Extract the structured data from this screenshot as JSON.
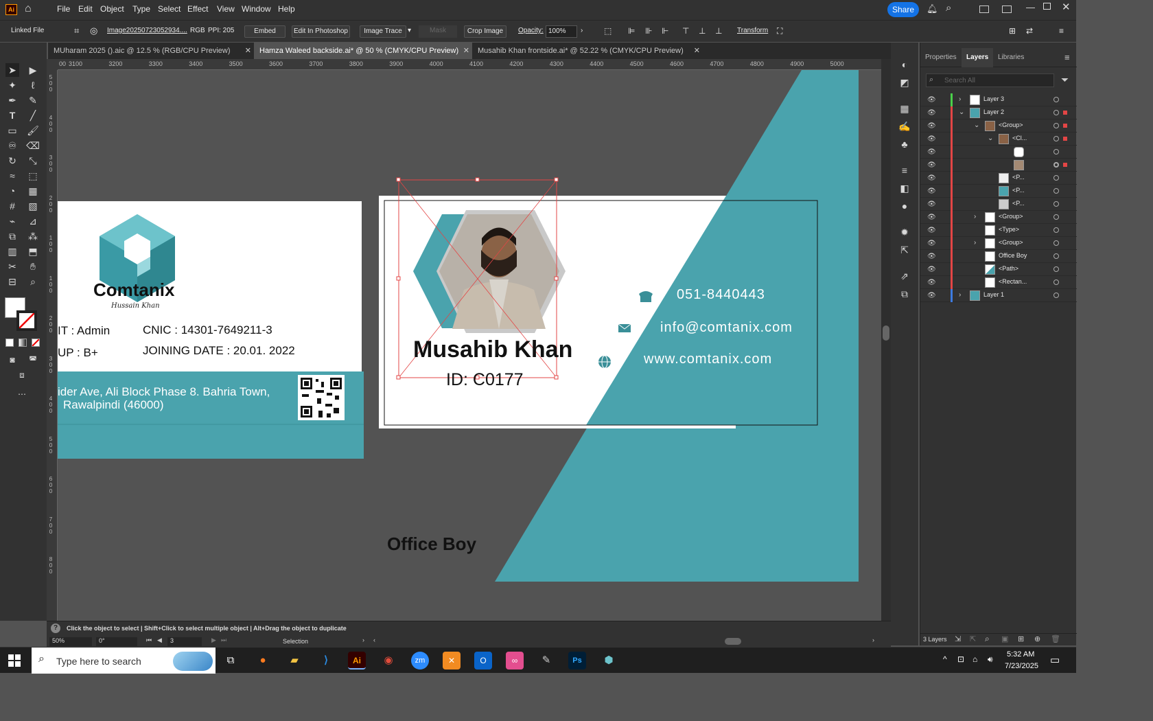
{
  "app": {
    "logo": "Ai",
    "menu": [
      "File",
      "Edit",
      "Object",
      "Type",
      "Select",
      "Effect",
      "View",
      "Window",
      "Help"
    ],
    "share": "Share"
  },
  "control": {
    "linked_file": "Linked File",
    "image_name": "Image20250723052934....",
    "color_mode": "RGB",
    "ppi": "PPI: 205",
    "embed": "Embed",
    "edit_photoshop": "Edit In Photoshop",
    "image_trace": "Image Trace",
    "mask": "Mask",
    "crop_image": "Crop Image",
    "opacity_label": "Opacity:",
    "opacity_value": "100%",
    "transform": "Transform"
  },
  "tabs": [
    {
      "label": "MUharam 2025 ().aic @ 12.5 % (RGB/CPU Preview)"
    },
    {
      "label": "Hamza Waleed backside.ai* @ 50 % (CMYK/CPU Preview)"
    },
    {
      "label": "Musahib Khan  frontside.ai* @ 52.22 % (CMYK/CPU Preview)"
    }
  ],
  "ruler_h": [
    "00",
    "3100",
    "3200",
    "3300",
    "3400",
    "3500",
    "3600",
    "3700",
    "3800",
    "3900",
    "4000",
    "4100",
    "4200",
    "4300",
    "4400",
    "4500",
    "4600",
    "4700",
    "4800",
    "4900",
    "5000"
  ],
  "ruler_v": [
    "5\n0\n0",
    "4\n0\n0",
    "3\n0\n0",
    "2\n0\n0",
    "1\n0\n0",
    "1\n0\n0",
    "2\n0\n0",
    "3\n0\n0",
    "4\n0\n0",
    "5\n0\n0",
    "6\n0\n0",
    "7\n0\n0",
    "8\n0\n0"
  ],
  "back_card": {
    "brand": "Comtanix",
    "signature": "Hussain Khan",
    "dept": "IT : Admin",
    "group": "UP : B+",
    "cnic": "CNIC : 14301-7649211-3",
    "joining": "JOINING DATE : 20.01. 2022",
    "address1": "ider Ave, Ali Block Phase 8. Bahria Town,",
    "address2": "Rawalpindi (46000)"
  },
  "front_card": {
    "name": "Musahib Khan",
    "id": "ID: C0177",
    "phone": "051-8440443",
    "email": "info@comtanix.com",
    "web": "www.comtanix.com",
    "role": "Office Boy"
  },
  "colors": {
    "teal": "#4aa3ad",
    "accent": "#1473e6",
    "selection": "#e34545"
  },
  "panel": {
    "tabs": [
      "Properties",
      "Layers",
      "Libraries"
    ],
    "search_placeholder": "Search All",
    "layers": [
      {
        "name": "Layer 3"
      },
      {
        "name": "Layer 2"
      },
      {
        "name": "<Group>"
      },
      {
        "name": "<Cl..."
      },
      {
        "name": ""
      },
      {
        "name": ""
      },
      {
        "name": "<P..."
      },
      {
        "name": "<P..."
      },
      {
        "name": "<P..."
      },
      {
        "name": "<Group>"
      },
      {
        "name": "<Type>"
      },
      {
        "name": "<Group>"
      },
      {
        "name": "Office Boy"
      },
      {
        "name": "<Path>"
      },
      {
        "name": "<Rectan..."
      },
      {
        "name": "Layer 1"
      }
    ],
    "footer": "3 Layers"
  },
  "status": {
    "hint": "Click the object to select  |  Shift+Click to select multiple object  |  Alt+Drag the object to duplicate",
    "zoom": "50%",
    "rotation": "0°",
    "artboard": "3",
    "tool": "Selection"
  },
  "taskbar": {
    "search": "Type here to search",
    "time": "5:32 AM",
    "date": "7/23/2025"
  }
}
